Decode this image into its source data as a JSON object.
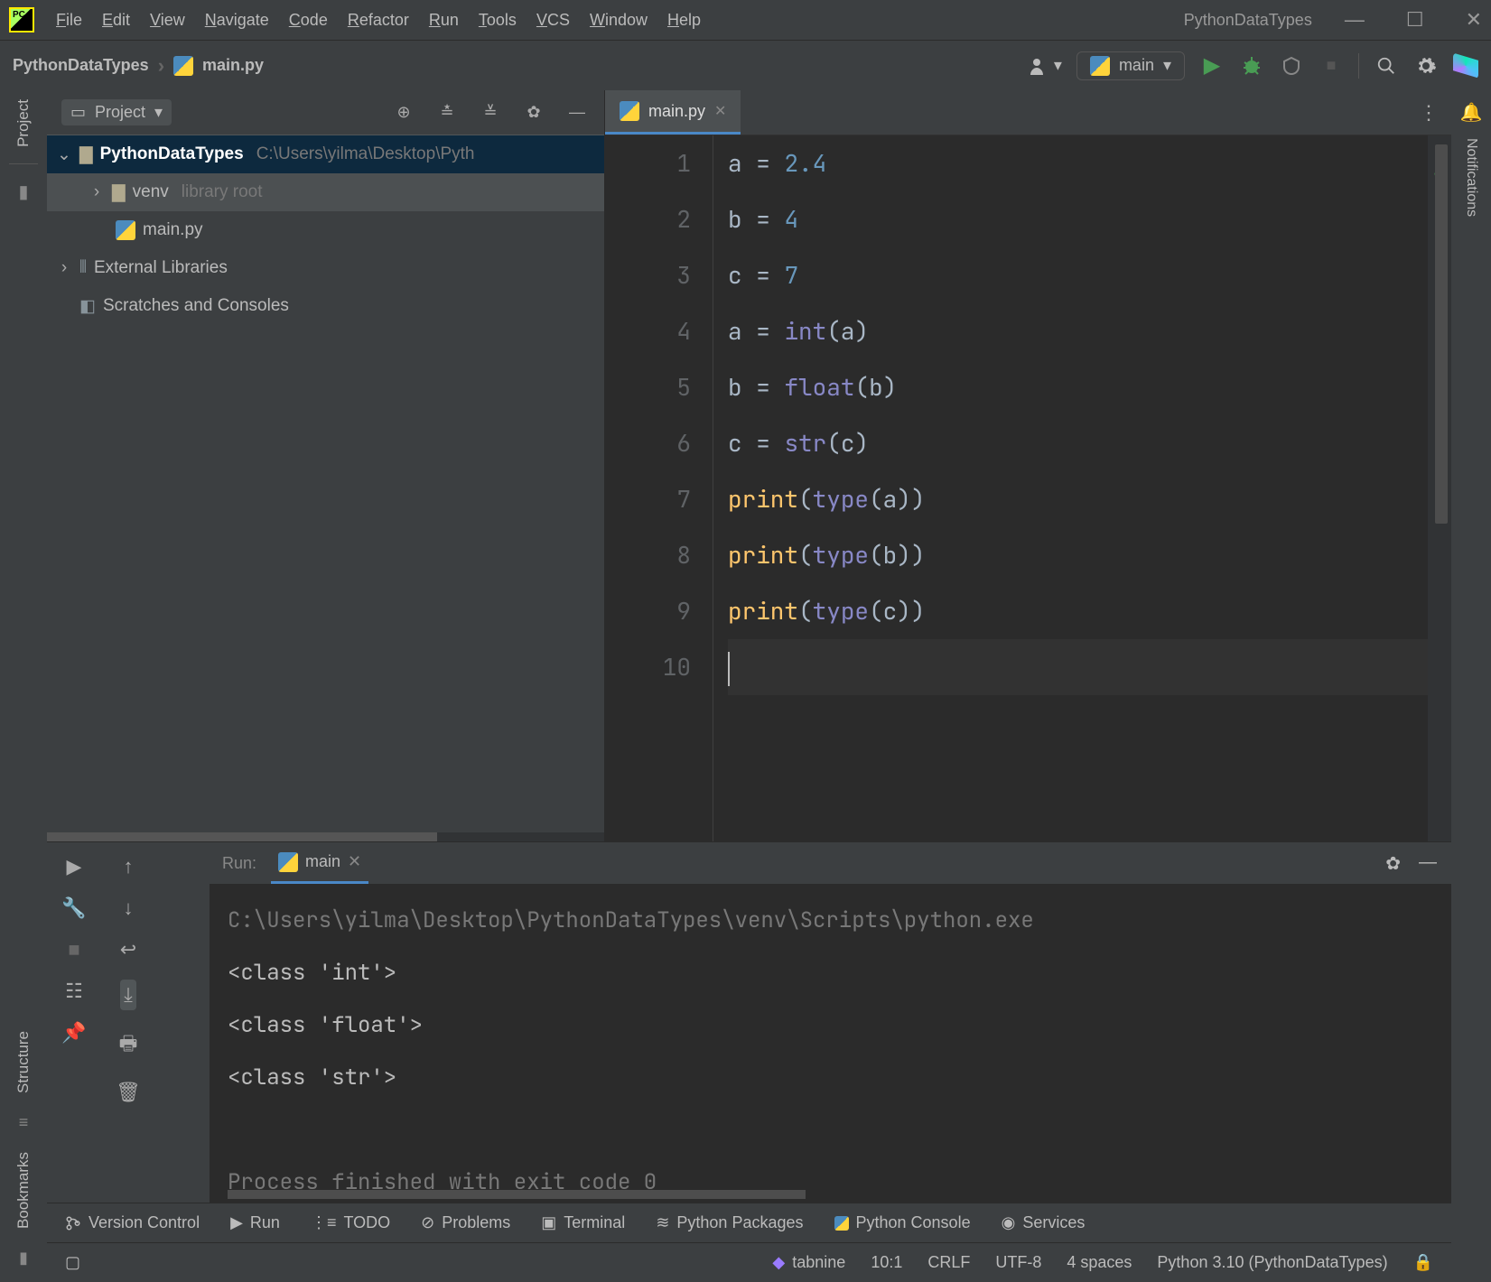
{
  "title": "PythonDataTypes",
  "menu": [
    "File",
    "Edit",
    "View",
    "Navigate",
    "Code",
    "Refactor",
    "Run",
    "Tools",
    "VCS",
    "Window",
    "Help"
  ],
  "breadcrumb": {
    "project": "PythonDataTypes",
    "file": "main.py"
  },
  "runConfig": {
    "name": "main"
  },
  "projectPanel": {
    "title": "Project",
    "root": {
      "name": "PythonDataTypes",
      "path": "C:\\Users\\yilma\\Desktop\\Pyth"
    },
    "venv": {
      "name": "venv",
      "tag": "library root"
    },
    "file": "main.py",
    "extLib": "External Libraries",
    "scratch": "Scratches and Consoles"
  },
  "editor": {
    "tab": "main.py",
    "lines": [
      [
        [
          "var",
          "a"
        ],
        [
          "sp",
          " "
        ],
        [
          "op",
          "="
        ],
        [
          "sp",
          " "
        ],
        [
          "num",
          "2.4"
        ]
      ],
      [
        [
          "var",
          "b"
        ],
        [
          "sp",
          " "
        ],
        [
          "op",
          "="
        ],
        [
          "sp",
          " "
        ],
        [
          "num",
          "4"
        ]
      ],
      [
        [
          "var",
          "c"
        ],
        [
          "sp",
          " "
        ],
        [
          "op",
          "="
        ],
        [
          "sp",
          " "
        ],
        [
          "num",
          "7"
        ]
      ],
      [
        [
          "var",
          "a"
        ],
        [
          "sp",
          " "
        ],
        [
          "op",
          "="
        ],
        [
          "sp",
          " "
        ],
        [
          "builtin",
          "int"
        ],
        [
          "par",
          "("
        ],
        [
          "var",
          "a"
        ],
        [
          "par",
          ")"
        ]
      ],
      [
        [
          "var",
          "b"
        ],
        [
          "sp",
          " "
        ],
        [
          "op",
          "="
        ],
        [
          "sp",
          " "
        ],
        [
          "builtin",
          "float"
        ],
        [
          "par",
          "("
        ],
        [
          "var",
          "b"
        ],
        [
          "par",
          ")"
        ]
      ],
      [
        [
          "var",
          "c"
        ],
        [
          "sp",
          " "
        ],
        [
          "op",
          "="
        ],
        [
          "sp",
          " "
        ],
        [
          "builtin",
          "str"
        ],
        [
          "par",
          "("
        ],
        [
          "var",
          "c"
        ],
        [
          "par",
          ")"
        ]
      ],
      [
        [
          "fn",
          "print"
        ],
        [
          "par",
          "("
        ],
        [
          "builtin",
          "type"
        ],
        [
          "par",
          "("
        ],
        [
          "var",
          "a"
        ],
        [
          "par",
          ")"
        ],
        [
          "par",
          ")"
        ]
      ],
      [
        [
          "fn",
          "print"
        ],
        [
          "par",
          "("
        ],
        [
          "builtin",
          "type"
        ],
        [
          "par",
          "("
        ],
        [
          "var",
          "b"
        ],
        [
          "par",
          ")"
        ],
        [
          "par",
          ")"
        ]
      ],
      [
        [
          "fn",
          "print"
        ],
        [
          "par",
          "("
        ],
        [
          "builtin",
          "type"
        ],
        [
          "par",
          "("
        ],
        [
          "var",
          "c"
        ],
        [
          "par",
          ")"
        ],
        [
          "par",
          ")"
        ]
      ],
      []
    ]
  },
  "runTool": {
    "label": "Run:",
    "tab": "main",
    "output": [
      {
        "cls": "dim",
        "text": "C:\\Users\\yilma\\Desktop\\PythonDataTypes\\venv\\Scripts\\python.exe"
      },
      {
        "cls": "",
        "text": "<class 'int'>"
      },
      {
        "cls": "",
        "text": "<class 'float'>"
      },
      {
        "cls": "",
        "text": "<class 'str'>"
      },
      {
        "cls": "",
        "text": ""
      },
      {
        "cls": "dim",
        "text": "Process finished with exit code 0"
      }
    ]
  },
  "leftTabs": {
    "project": "Project",
    "structure": "Structure",
    "bookmarks": "Bookmarks"
  },
  "rightTabs": {
    "notifications": "Notifications"
  },
  "bottomTools": {
    "vcs": "Version Control",
    "run": "Run",
    "todo": "TODO",
    "problems": "Problems",
    "terminal": "Terminal",
    "packages": "Python Packages",
    "console": "Python Console",
    "services": "Services"
  },
  "status": {
    "tabnine": "tabnine",
    "pos": "10:1",
    "eol": "CRLF",
    "enc": "UTF-8",
    "indent": "4 spaces",
    "interp": "Python 3.10 (PythonDataTypes)"
  }
}
